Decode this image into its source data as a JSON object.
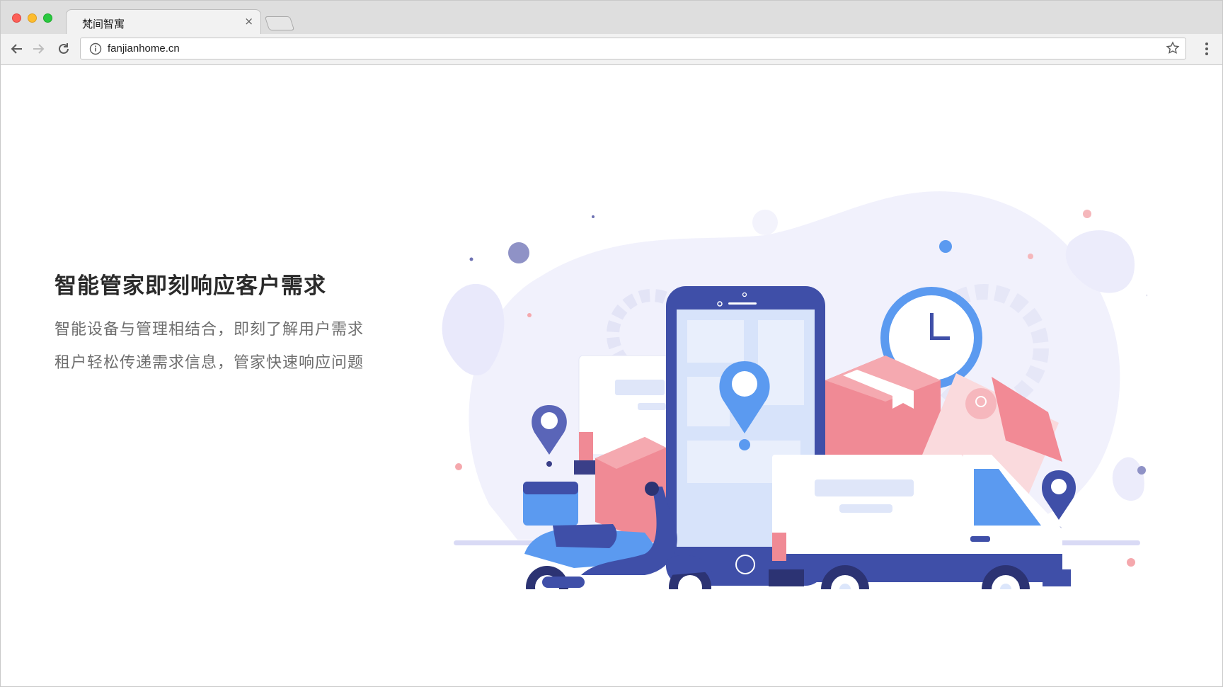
{
  "browser": {
    "tab_title": "梵间智寓",
    "tab_close": "×",
    "url": "fanjianhome.cn"
  },
  "hero": {
    "headline": "智能管家即刻响应客户需求",
    "line1": "智能设备与管理相结合，即刻了解用户需求",
    "line2": "租户轻松传递需求信息，管家快速响应问题"
  },
  "icons": [
    "back-arrow-icon",
    "forward-arrow-icon",
    "reload-icon",
    "info-icon",
    "star-icon",
    "menu-dots-icon",
    "location-pin-icon",
    "clock-icon",
    "package-icon",
    "truck-icon",
    "scooter-icon",
    "phone-icon"
  ],
  "colors": {
    "primary_blue": "#3f4fa8",
    "accent_blue": "#5b9af0",
    "pink": "#f08a95",
    "light_bg": "#eef0fb"
  }
}
